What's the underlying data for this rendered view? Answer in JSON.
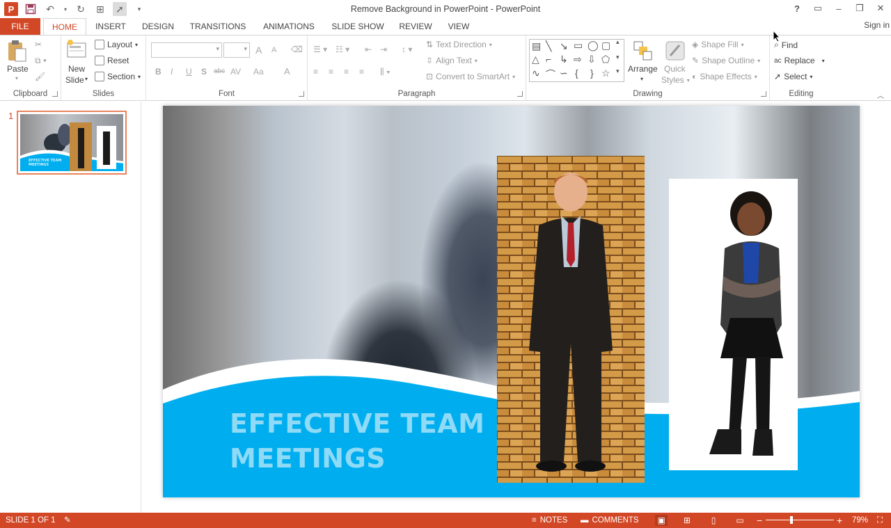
{
  "window": {
    "title": "Remove Background in PowerPoint - PowerPoint",
    "help": "?",
    "restore": "▭",
    "minimize": "–",
    "maximize": "❐",
    "close": "✕"
  },
  "quick_access": {
    "app_icon": "P",
    "icons": [
      "save-icon",
      "undo-icon",
      "redo-icon",
      "touch-mode-icon",
      "select-pointer-icon",
      "customize-icon"
    ]
  },
  "tabs": [
    {
      "label": "FILE"
    },
    {
      "label": "HOME",
      "selected": true
    },
    {
      "label": "INSERT"
    },
    {
      "label": "DESIGN"
    },
    {
      "label": "TRANSITIONS"
    },
    {
      "label": "ANIMATIONS"
    },
    {
      "label": "SLIDE SHOW"
    },
    {
      "label": "REVIEW"
    },
    {
      "label": "VIEW"
    }
  ],
  "signin": "Sign in",
  "ribbon": {
    "clipboard": {
      "label": "Clipboard",
      "paste": "Paste"
    },
    "slides": {
      "label": "Slides",
      "new_slide_1": "New",
      "new_slide_2": "Slide",
      "layout": "Layout",
      "reset": "Reset",
      "section": "Section"
    },
    "font": {
      "label": "Font",
      "bold": "B",
      "italic": "I",
      "underline": "U",
      "shadow": "S",
      "strike": "abc",
      "spacing": "AV",
      "case": "Aa",
      "color": "A",
      "grow": "A",
      "shrink": "A"
    },
    "paragraph": {
      "label": "Paragraph",
      "text_direction": "Text Direction",
      "align_text": "Align Text",
      "convert_smartart": "Convert to SmartArt"
    },
    "drawing": {
      "label": "Drawing",
      "arrange": "Arrange",
      "quick_styles_1": "Quick",
      "quick_styles_2": "Styles",
      "shape_fill": "Shape Fill",
      "shape_outline": "Shape Outline",
      "shape_effects": "Shape Effects"
    },
    "editing": {
      "label": "Editing",
      "find": "Find",
      "replace": "Replace",
      "select": "Select"
    }
  },
  "thumbnails": [
    {
      "number": "1",
      "title": "EFFECTIVE TEAM MEETINGS"
    }
  ],
  "slide": {
    "title_line1": "EFFECTIVE TEAM",
    "title_line2": "MEETINGS"
  },
  "status": {
    "slide_indicator": "SLIDE 1 OF 1",
    "notes": "NOTES",
    "comments": "COMMENTS",
    "zoom": "79%"
  },
  "colors": {
    "accent": "#d24726",
    "slide_blue": "#00aeef",
    "title_text": "#8fdaf6"
  }
}
